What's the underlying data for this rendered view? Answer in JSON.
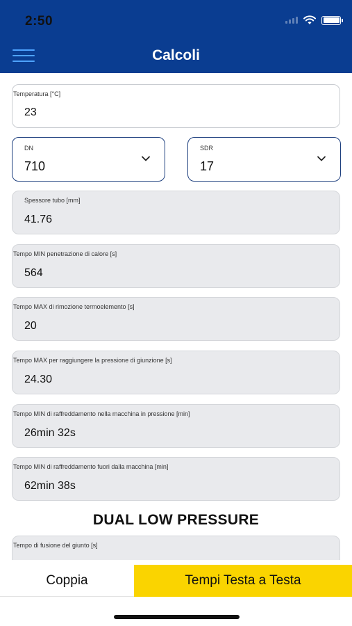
{
  "status_bar": {
    "time": "2:50"
  },
  "header": {
    "title": "Calcoli"
  },
  "fields": {
    "temperatura": {
      "label": "Temperatura [°C]",
      "value": "23"
    },
    "dn": {
      "label": "DN",
      "value": "710"
    },
    "sdr": {
      "label": "SDR",
      "value": "17"
    },
    "spessore": {
      "label": "Spessore tubo [mm]",
      "value": "41.76"
    },
    "tempo_penetrazione": {
      "label": "Tempo MIN penetrazione di calore [s]",
      "value": "564"
    },
    "tempo_rimozione": {
      "label": "Tempo MAX di rimozione termoelemento [s]",
      "value": "20"
    },
    "tempo_pressione": {
      "label": "Tempo MAX per raggiungere la pressione di giunzione [s]",
      "value": "24.30"
    },
    "tempo_raffreddamento_in": {
      "label": "Tempo MIN di raffreddamento nella macchina in pressione [min]",
      "value": "26min 32s"
    },
    "tempo_raffreddamento_fuori": {
      "label": "Tempo MIN di raffreddamento fuori dalla macchina [min]",
      "value": "62min 38s"
    },
    "tempo_fusione": {
      "label": "Tempo di fusione del giunto [s]",
      "value": ""
    }
  },
  "section": {
    "dual_low_pressure": "DUAL LOW PRESSURE"
  },
  "tabs": {
    "coppia": "Coppia",
    "tempi": "Tempi Testa a Testa"
  },
  "colors": {
    "header": "#0a3d91",
    "active_tab": "#fad400",
    "readonly_bg": "#e9eaed"
  }
}
